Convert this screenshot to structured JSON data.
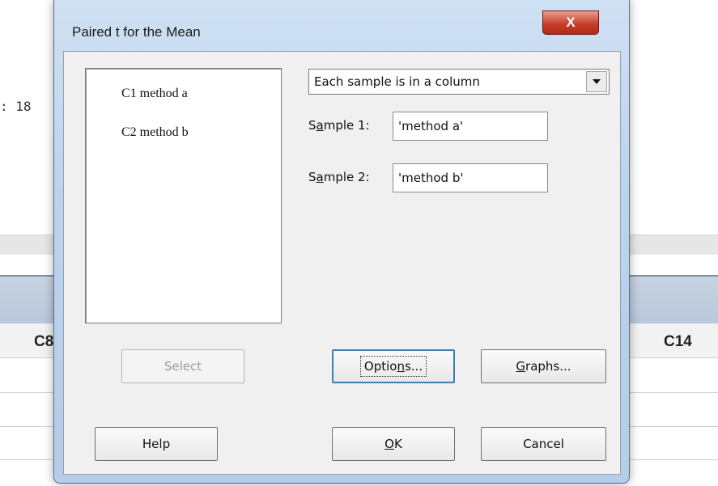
{
  "background": {
    "session_text": ": 18",
    "column_left": "C8",
    "column_right": "C14"
  },
  "dialog": {
    "title": "Paired t for the Mean",
    "close_label": "X",
    "variables": [
      "C1 method a",
      "C2 method b"
    ],
    "mode_select": "Each sample is in a column",
    "sample1": {
      "label_pre": "S",
      "label_u": "a",
      "label_post": "mple 1:",
      "value": "'method a'"
    },
    "sample2": {
      "label_pre": "S",
      "label_u": "a",
      "label_post": "mple 2:",
      "value": "'method b'"
    },
    "buttons": {
      "select": "Select",
      "options_pre": "Optio",
      "options_u": "n",
      "options_post": "s...",
      "graphs_u": "G",
      "graphs_post": "raphs...",
      "help": "Help",
      "ok_u": "O",
      "ok_post": "K",
      "cancel": "Cancel"
    }
  }
}
